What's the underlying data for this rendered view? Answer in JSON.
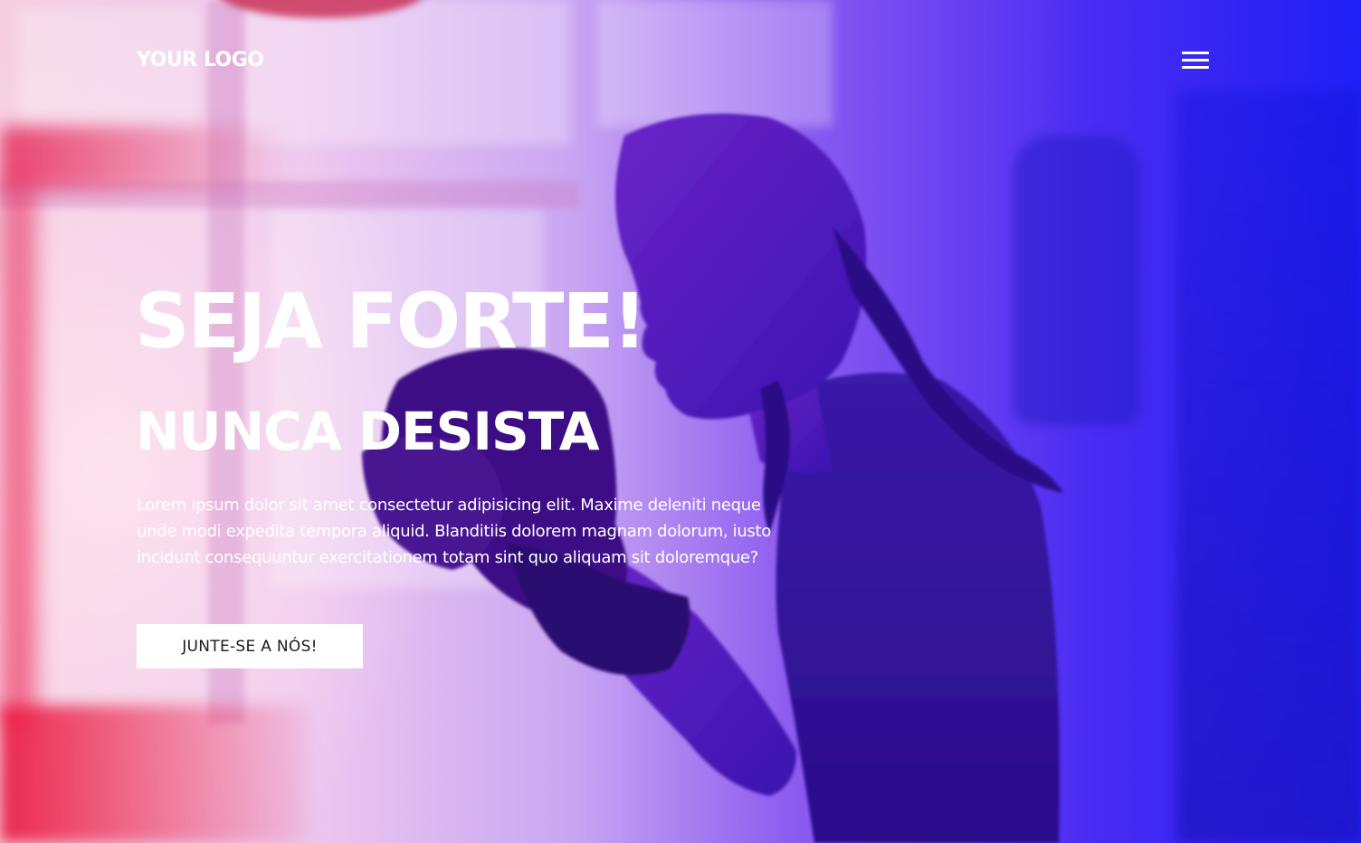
{
  "header": {
    "logo_text": "YOUR LOGO",
    "menu_icon": "hamburger-menu-icon"
  },
  "hero": {
    "title": "SEJA FORTE!",
    "subtitle": "NUNCA DESISTA",
    "description": "Lorem ipsum dolor sit amet consectetur adipisicing elit. Maxime deleniti neque unde modi expedita tempora aliquid. Blanditiis dolorem magnam dolorum, iusto incidunt consequuntur exercitationem totam sint quo aliquam sit doloremque?",
    "cta_label": "JUNTE-SE A NÓS!"
  },
  "colors": {
    "overlay_left": "#f5cfe0",
    "overlay_mid": "#8d5cf0",
    "overlay_right": "#1f1ff5",
    "text": "#ffffff",
    "button_bg": "#ffffff",
    "button_text": "#1a1a1a"
  }
}
